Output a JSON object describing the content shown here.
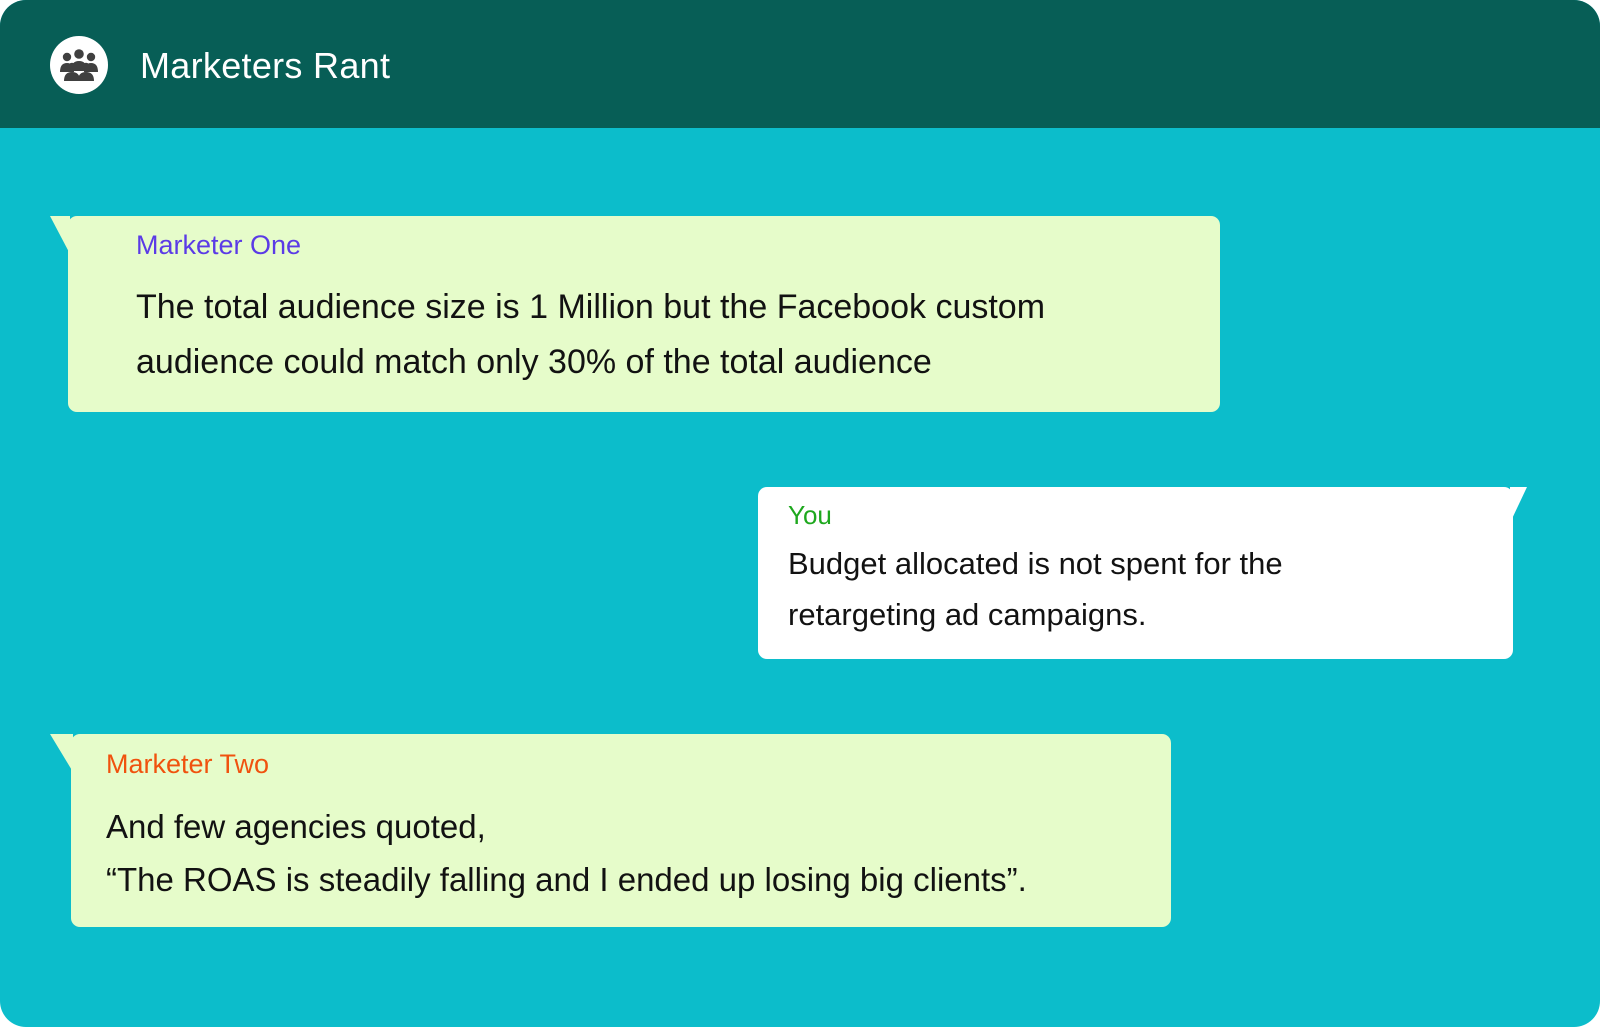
{
  "header": {
    "title": "Marketers Rant",
    "avatar_icon": "group-icon",
    "background": "#075e56"
  },
  "chat": {
    "background": "#0cbdcb",
    "messages": [
      {
        "direction": "incoming",
        "sender": "Marketer One",
        "sender_color": "#5b3be6",
        "lines": [
          "The total audience size is 1 Million but the Facebook custom",
          "audience could match only 30% of the total audience"
        ]
      },
      {
        "direction": "outgoing",
        "sender": "You",
        "sender_color": "#1ea81e",
        "lines": [
          "Budget allocated is not spent for the",
          "retargeting ad campaigns."
        ]
      },
      {
        "direction": "incoming",
        "sender": "Marketer Two",
        "sender_color": "#f0520e",
        "lines": [
          "And few agencies quoted,",
          "“The ROAS is steadily falling and I ended up losing big clients”."
        ]
      }
    ]
  },
  "colors": {
    "incoming_bubble": "#e6fcca",
    "outgoing_bubble": "#ffffff",
    "message_text": "#121212"
  }
}
